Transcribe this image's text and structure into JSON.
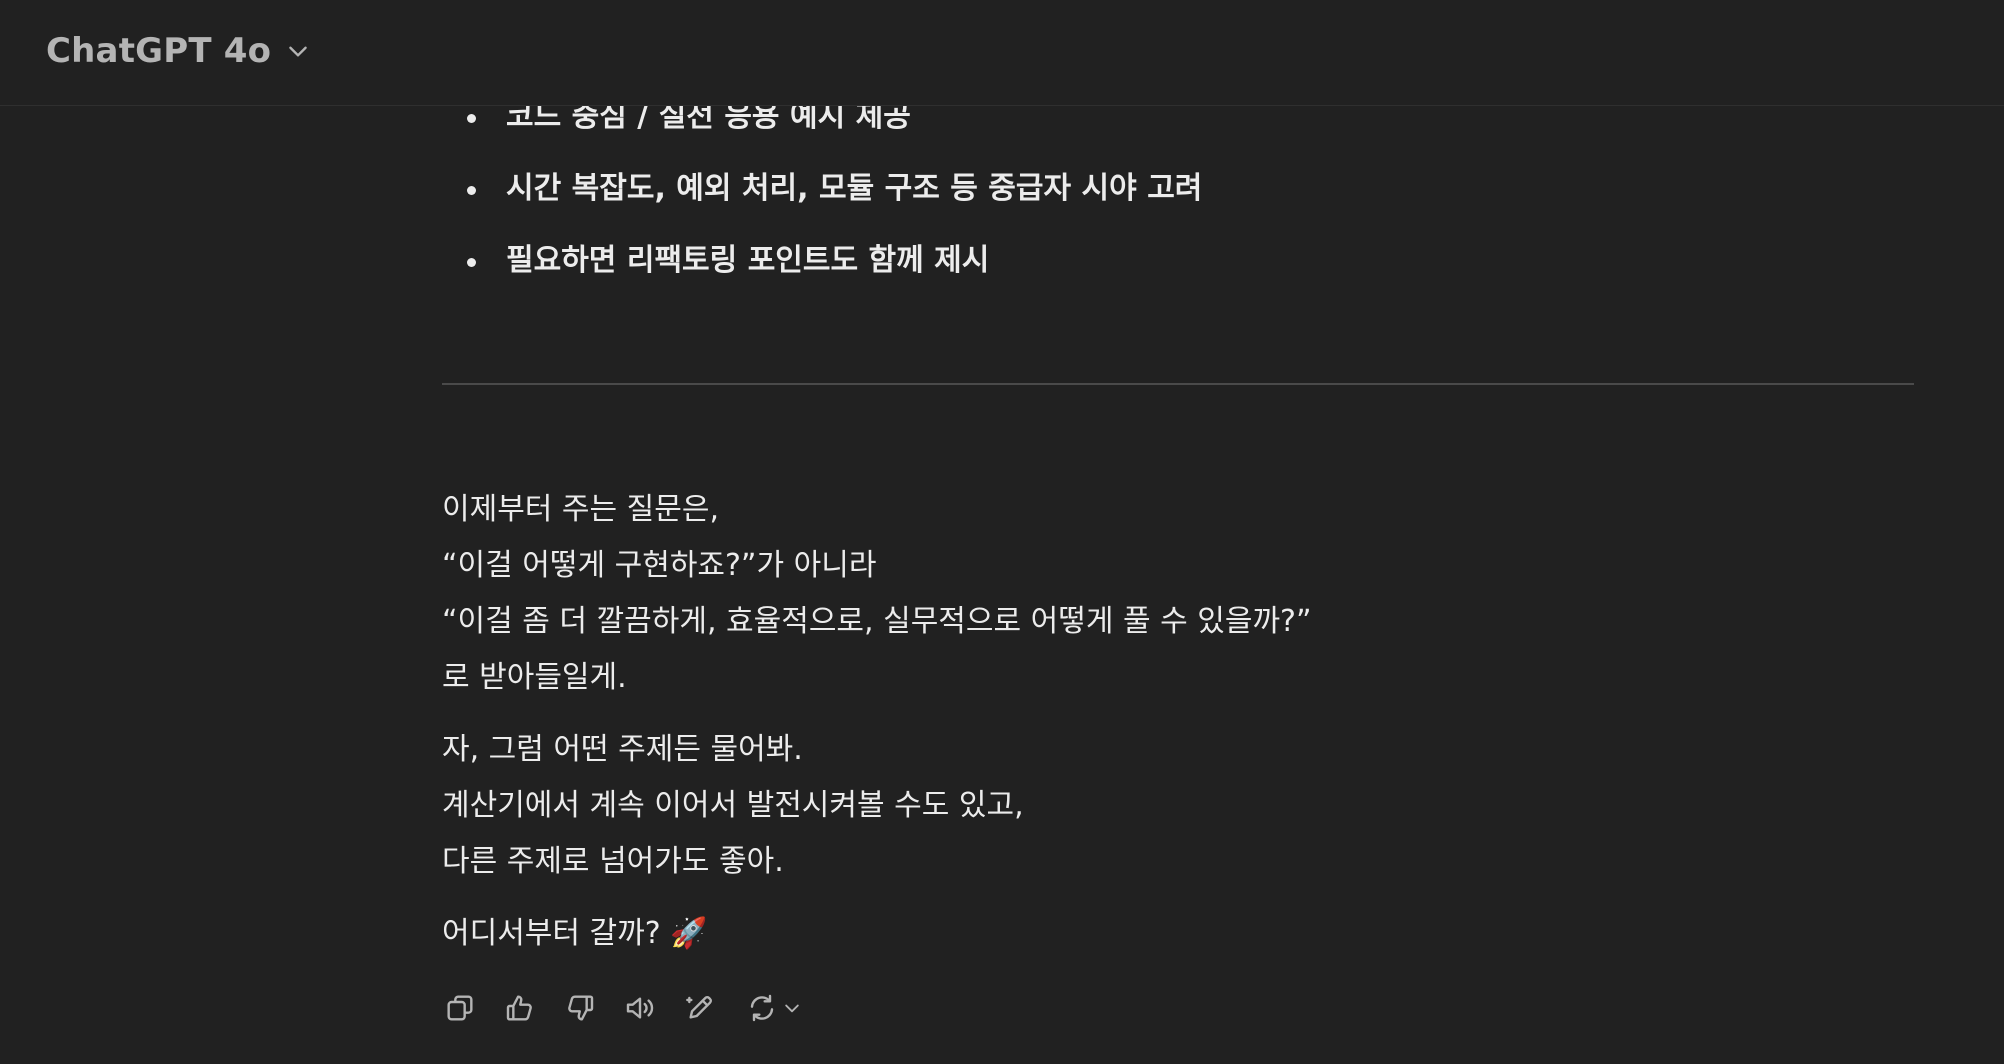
{
  "header": {
    "model_name": "ChatGPT 4o"
  },
  "message": {
    "bullets": [
      "코드 중심 / 실전 응용 예시 제공",
      "시간 복잡도, 예외 처리, 모듈 구조 등 중급자 시야 고려",
      "필요하면 리팩토링 포인트도 함께 제시"
    ],
    "paragraph1": [
      "이제부터 주는 질문은,",
      "“이걸 어떻게 구현하죠?”가 아니라",
      "“이걸 좀 더 깔끔하게, 효율적으로, 실무적으로 어떻게 풀 수 있을까?”",
      "로 받아들일게."
    ],
    "paragraph2": [
      "자, 그럼 어떤 주제든 물어봐.",
      "계산기에서 계속 이어서 발전시켜볼 수도 있고,",
      "다른 주제로 넘어가도 좋아."
    ],
    "closing_text": "어디서부터 갈까?",
    "closing_emoji": "🚀"
  },
  "actions": {
    "icons": [
      "copy-icon",
      "thumbs-up-icon",
      "thumbs-down-icon",
      "read-aloud-icon",
      "edit-icon",
      "regenerate-icon",
      "chevron-down-icon"
    ]
  },
  "colors": {
    "background": "#212121",
    "text": "#ececec",
    "muted": "#b4b4b4",
    "divider": "#4a4a4a"
  }
}
